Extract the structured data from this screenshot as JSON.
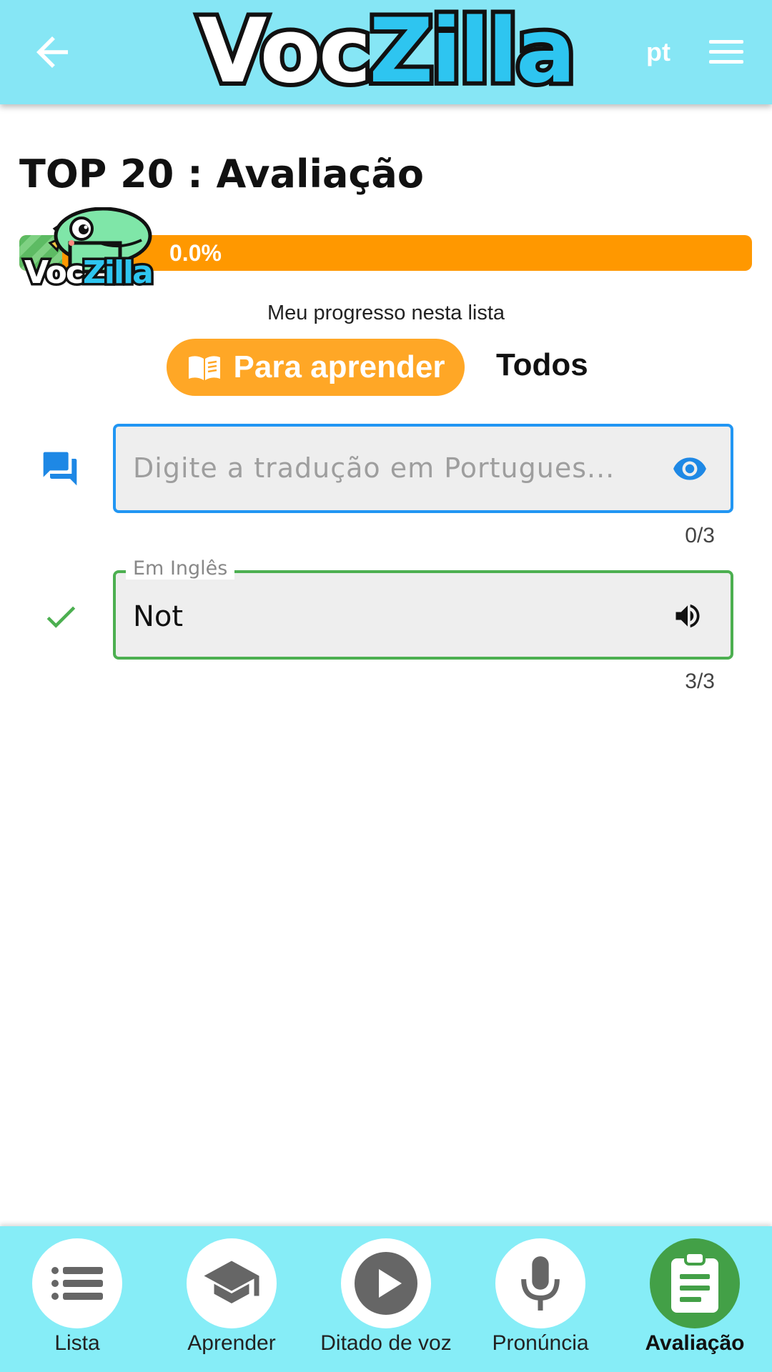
{
  "header": {
    "logo_voc": "Voc",
    "logo_zilla": "Zilla",
    "language": "pt",
    "icons": {
      "back": "arrow-left-icon",
      "menu": "hamburger-menu-icon"
    }
  },
  "page": {
    "title": "TOP 20 : Avaliação",
    "progress": {
      "percent": 0.0,
      "label": "0.0%",
      "caption": "Meu progresso nesta lista"
    },
    "mascot": {
      "word_voc": "Voc",
      "word_zilla": "Zilla"
    }
  },
  "tabs": [
    {
      "label": "Para aprender",
      "icon": "book-icon",
      "active": true
    },
    {
      "label": "Todos",
      "active": false
    }
  ],
  "fields": [
    {
      "placeholder": "Digite a tradução em Portugues...",
      "value": "",
      "counter": "0/3",
      "leading_icon": "chat-icon",
      "trailing_icon": "eye-icon"
    },
    {
      "label": "Em Inglês",
      "value": "Not",
      "counter": "3/3",
      "leading_icon": "checkmark-icon",
      "trailing_icon": "speaker-icon"
    }
  ],
  "bottom_nav": [
    {
      "label": "Lista",
      "icon": "list-icon",
      "active": false
    },
    {
      "label": "Aprender",
      "icon": "graduation-cap-icon",
      "active": false
    },
    {
      "label": "Ditado de voz",
      "icon": "play-icon",
      "active": false
    },
    {
      "label": "Pronúncia",
      "icon": "microphone-icon",
      "active": false
    },
    {
      "label": "Avaliação",
      "icon": "clipboard-icon",
      "active": true
    }
  ],
  "colors": {
    "topbar": "#86E6F5",
    "accent_orange": "#FF9800",
    "tab_active": "#FFA726",
    "focus_blue": "#2196F3",
    "success_green": "#4CAF50",
    "nav_active": "#43A047"
  }
}
